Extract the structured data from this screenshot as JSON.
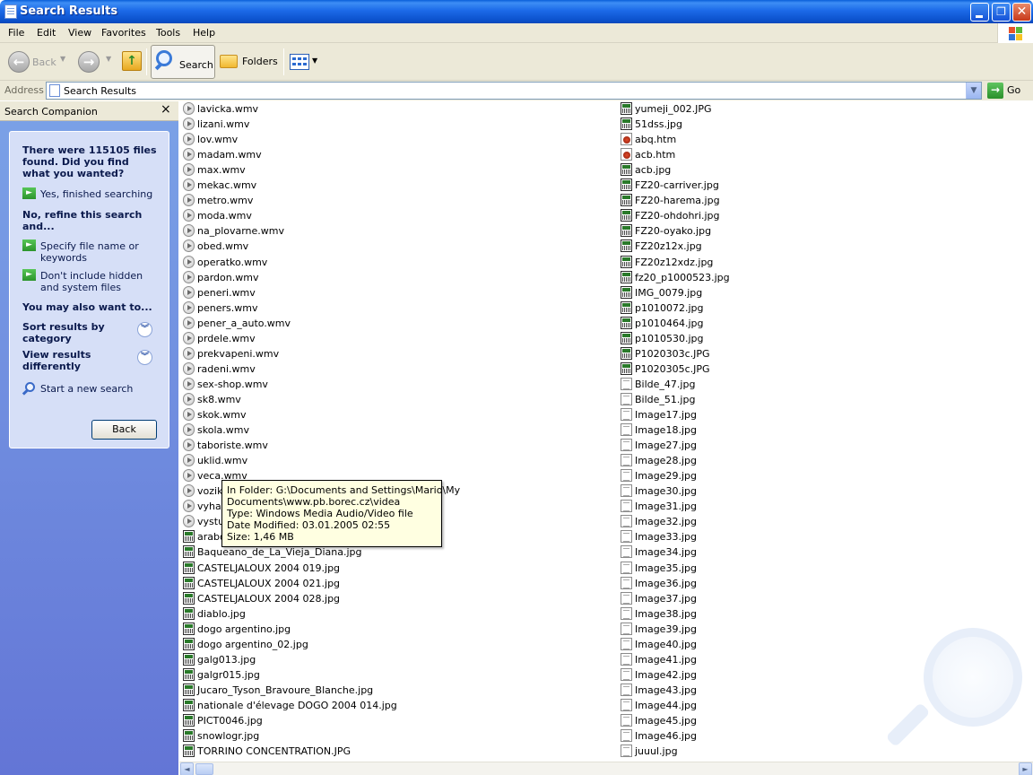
{
  "window": {
    "title": "Search Results"
  },
  "menu": [
    "File",
    "Edit",
    "View",
    "Favorites",
    "Tools",
    "Help"
  ],
  "toolbar": {
    "back": "Back",
    "search": "Search",
    "folders": "Folders"
  },
  "address": {
    "label": "Address",
    "value": "Search Results",
    "go": "Go"
  },
  "companion": {
    "title": "Search Companion",
    "close": "×",
    "found_text": "There were 115105 files found. Did you find what you wanted?",
    "yes": "Yes, finished searching",
    "refine": "No, refine this search and...",
    "specify": "Specify file name or keywords",
    "hidden": "Don't include hidden and system files",
    "also": "You may also want to...",
    "sort": "Sort results by category",
    "view": "View results differently",
    "start": "Start a new search",
    "back": "Back"
  },
  "files_left": [
    {
      "name": "lavicka.wmv",
      "type": "wmv"
    },
    {
      "name": "lizani.wmv",
      "type": "wmv"
    },
    {
      "name": "lov.wmv",
      "type": "wmv"
    },
    {
      "name": "madam.wmv",
      "type": "wmv"
    },
    {
      "name": "max.wmv",
      "type": "wmv"
    },
    {
      "name": "mekac.wmv",
      "type": "wmv"
    },
    {
      "name": "metro.wmv",
      "type": "wmv"
    },
    {
      "name": "moda.wmv",
      "type": "wmv"
    },
    {
      "name": "na_plovarne.wmv",
      "type": "wmv"
    },
    {
      "name": "obed.wmv",
      "type": "wmv"
    },
    {
      "name": "operatko.wmv",
      "type": "wmv"
    },
    {
      "name": "pardon.wmv",
      "type": "wmv"
    },
    {
      "name": "peneri.wmv",
      "type": "wmv"
    },
    {
      "name": "peners.wmv",
      "type": "wmv"
    },
    {
      "name": "pener_a_auto.wmv",
      "type": "wmv"
    },
    {
      "name": "prdele.wmv",
      "type": "wmv"
    },
    {
      "name": "prekvapeni.wmv",
      "type": "wmv"
    },
    {
      "name": "radeni.wmv",
      "type": "wmv"
    },
    {
      "name": "sex-shop.wmv",
      "type": "wmv"
    },
    {
      "name": "sk8.wmv",
      "type": "wmv"
    },
    {
      "name": "skok.wmv",
      "type": "wmv"
    },
    {
      "name": "skola.wmv",
      "type": "wmv"
    },
    {
      "name": "taboriste.wmv",
      "type": "wmv"
    },
    {
      "name": "uklid.wmv",
      "type": "wmv"
    },
    {
      "name": "veca.wmv",
      "type": "wmv"
    },
    {
      "name": "vozik",
      "type": "wmv"
    },
    {
      "name": "vyhaz",
      "type": "wmv"
    },
    {
      "name": "vystu",
      "type": "wmv"
    },
    {
      "name": "arabo",
      "type": "img"
    },
    {
      "name": "Baqueano_de_La_Vieja_Diana.jpg",
      "type": "img"
    },
    {
      "name": "CASTELJALOUX 2004 019.jpg",
      "type": "img"
    },
    {
      "name": "CASTELJALOUX 2004 021.jpg",
      "type": "img"
    },
    {
      "name": "CASTELJALOUX 2004 028.jpg",
      "type": "img"
    },
    {
      "name": "diablo.jpg",
      "type": "img"
    },
    {
      "name": "dogo argentino.jpg",
      "type": "img"
    },
    {
      "name": "dogo argentino_02.jpg",
      "type": "img"
    },
    {
      "name": "galg013.jpg",
      "type": "img"
    },
    {
      "name": "galgr015.jpg",
      "type": "img"
    },
    {
      "name": "Jucaro_Tyson_Bravoure_Blanche.jpg",
      "type": "img"
    },
    {
      "name": "nationale d'élevage DOGO 2004 014.jpg",
      "type": "img"
    },
    {
      "name": "PICT0046.jpg",
      "type": "img"
    },
    {
      "name": "snowlogr.jpg",
      "type": "img"
    },
    {
      "name": "TORRINO CONCENTRATION.JPG",
      "type": "img"
    }
  ],
  "files_right": [
    {
      "name": "yumeji_002.JPG",
      "type": "img"
    },
    {
      "name": "51dss.jpg",
      "type": "img"
    },
    {
      "name": "abq.htm",
      "type": "htm"
    },
    {
      "name": "acb.htm",
      "type": "htm"
    },
    {
      "name": "acb.jpg",
      "type": "img"
    },
    {
      "name": "FZ20-carriver.jpg",
      "type": "img"
    },
    {
      "name": "FZ20-harema.jpg",
      "type": "img"
    },
    {
      "name": "FZ20-ohdohri.jpg",
      "type": "img"
    },
    {
      "name": "FZ20-oyako.jpg",
      "type": "img"
    },
    {
      "name": "FZ20z12x.jpg",
      "type": "img"
    },
    {
      "name": "FZ20z12xdz.jpg",
      "type": "img"
    },
    {
      "name": "fz20_p1000523.jpg",
      "type": "img"
    },
    {
      "name": "IMG_0079.jpg",
      "type": "img"
    },
    {
      "name": "p1010072.jpg",
      "type": "img"
    },
    {
      "name": "p1010464.jpg",
      "type": "img"
    },
    {
      "name": "p1010530.jpg",
      "type": "img"
    },
    {
      "name": "P1020303c.JPG",
      "type": "img"
    },
    {
      "name": "P1020305c.JPG",
      "type": "img"
    },
    {
      "name": "Bilde_47.jpg",
      "type": "jpgp"
    },
    {
      "name": "Bilde_51.jpg",
      "type": "jpgp"
    },
    {
      "name": "Image17.jpg",
      "type": "jpgp"
    },
    {
      "name": "Image18.jpg",
      "type": "jpgp"
    },
    {
      "name": "Image27.jpg",
      "type": "jpgp"
    },
    {
      "name": "Image28.jpg",
      "type": "jpgp"
    },
    {
      "name": "Image29.jpg",
      "type": "jpgp"
    },
    {
      "name": "Image30.jpg",
      "type": "jpgp"
    },
    {
      "name": "Image31.jpg",
      "type": "jpgp"
    },
    {
      "name": "Image32.jpg",
      "type": "jpgp"
    },
    {
      "name": "Image33.jpg",
      "type": "jpgp"
    },
    {
      "name": "Image34.jpg",
      "type": "jpgp"
    },
    {
      "name": "Image35.jpg",
      "type": "jpgp"
    },
    {
      "name": "Image36.jpg",
      "type": "jpgp"
    },
    {
      "name": "Image37.jpg",
      "type": "jpgp"
    },
    {
      "name": "Image38.jpg",
      "type": "jpgp"
    },
    {
      "name": "Image39.jpg",
      "type": "jpgp"
    },
    {
      "name": "Image40.jpg",
      "type": "jpgp"
    },
    {
      "name": "Image41.jpg",
      "type": "jpgp"
    },
    {
      "name": "Image42.jpg",
      "type": "jpgp"
    },
    {
      "name": "Image43.jpg",
      "type": "jpgp"
    },
    {
      "name": "Image44.jpg",
      "type": "jpgp"
    },
    {
      "name": "Image45.jpg",
      "type": "jpgp"
    },
    {
      "name": "Image46.jpg",
      "type": "jpgp"
    },
    {
      "name": "juuul.jpg",
      "type": "jpgp"
    }
  ],
  "tooltip": {
    "line1": "In Folder: G:\\Documents and Settings\\Mario\\My",
    "line2": "Documents\\www.pb.borec.cz\\videa",
    "line3": "Type: Windows Media Audio/Video file",
    "line4": "Date Modified: 03.01.2005 02:55",
    "line5": "Size: 1,46 MB"
  }
}
